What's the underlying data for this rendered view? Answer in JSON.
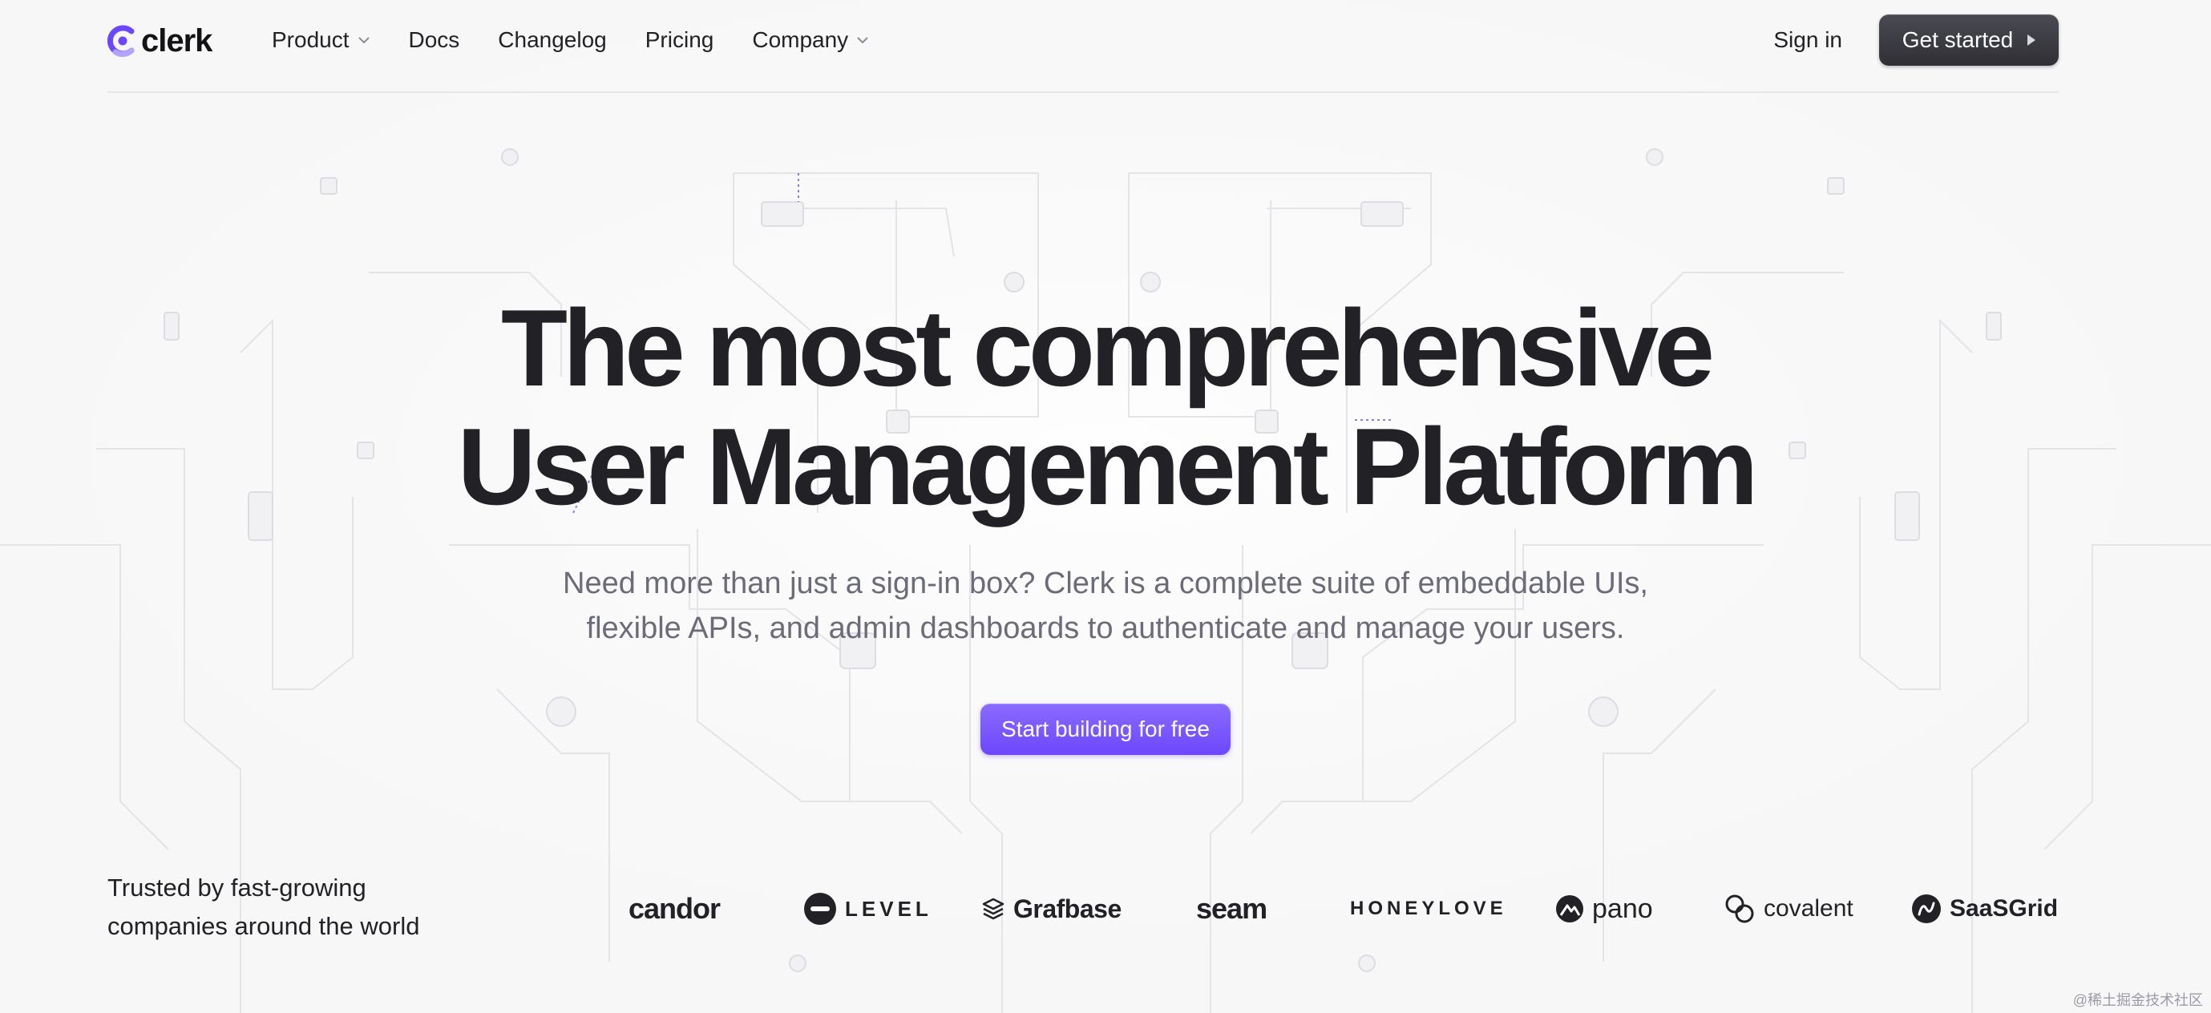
{
  "brand": {
    "name": "clerk",
    "accent": "#6c47ff"
  },
  "nav": {
    "items": [
      {
        "label": "Product",
        "has_dropdown": true
      },
      {
        "label": "Docs",
        "has_dropdown": false
      },
      {
        "label": "Changelog",
        "has_dropdown": false
      },
      {
        "label": "Pricing",
        "has_dropdown": false
      },
      {
        "label": "Company",
        "has_dropdown": true
      }
    ],
    "sign_in": "Sign in",
    "get_started": "Get started"
  },
  "hero": {
    "headline_line1": "The most comprehensive",
    "headline_line2": "User Management Platform",
    "subtitle_line1": "Need more than just a sign-in box? Clerk is a complete suite of embeddable UIs,",
    "subtitle_line2": "flexible APIs, and admin dashboards to authenticate and manage your users.",
    "cta": "Start building for free"
  },
  "trusted": {
    "line1": "Trusted by fast-growing",
    "line2": "companies around the world"
  },
  "logos": [
    "candor",
    "LEVEL",
    "Grafbase",
    "seam",
    "HONEYLOVE",
    "pano",
    "covalent",
    "SaaSGrid"
  ],
  "watermark": "@稀土掘金技术社区",
  "colors": {
    "text": "#212126",
    "muted": "#6c6c78",
    "button_dark": "#2f2f35",
    "button_primary": "#6c47ff"
  }
}
